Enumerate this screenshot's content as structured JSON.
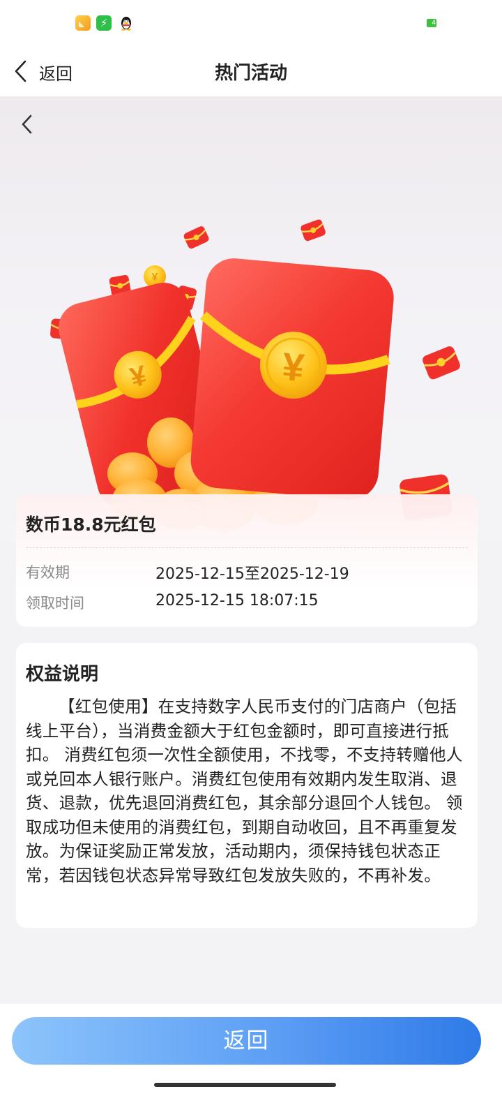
{
  "status_bar": {
    "battery_level": "4",
    "icons": [
      "gallery-app-icon",
      "charging-bolt-icon",
      "qq-penguin-icon"
    ]
  },
  "nav": {
    "back_label": "返回",
    "title": "热门活动"
  },
  "hero": {
    "currency_symbol": "¥",
    "image": "red-envelope-illustration"
  },
  "card": {
    "title": "数币18.8元红包",
    "rows": [
      {
        "label": "有效期",
        "value": "2025-12-15至2025-12-19"
      },
      {
        "label": "领取时间",
        "value": "2025-12-15 18:07:15"
      }
    ]
  },
  "benefit": {
    "title": "权益说明",
    "text": "【红包使用】在支持数字人民币支付的门店商户（包括线上平台），当消费金额大于红包金额时，即可直接进行抵扣。 消费红包须一次性全额使用，不找零，不支持转赠他人或兑回本人银行账户。消费红包使用有效期内发生取消、退货、退款，优先退回消费红包，其余部分退回个人钱包。 领取成功但未使用的消费红包，到期自动收回，且不再重复发放。为保证奖励正常发放，活动期内，须保持钱包状态正常，若因钱包状态异常导致红包发放失败的，不再补发。"
  },
  "footer": {
    "button_label": "返回"
  },
  "colors": {
    "envelope_red": "#f0302a",
    "coin_gold": "#ffc21a",
    "button_start": "#8dc4fb",
    "button_end": "#2f7ae8"
  }
}
